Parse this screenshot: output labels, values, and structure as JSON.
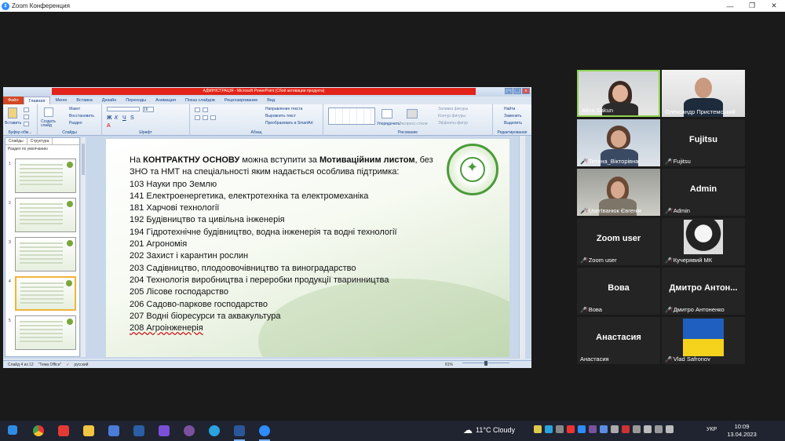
{
  "window": {
    "title": "Zoom Конференция",
    "controls": [
      "—",
      "❐",
      "✕"
    ]
  },
  "ppt": {
    "title": "АДМІНІСТРАЦІЯ - Microsoft PowerPoint (Сбой активации продукта)",
    "tabs": [
      "Файл",
      "Главная",
      "Меню",
      "Вставка",
      "Дизайн",
      "Переходы",
      "Анимация",
      "Показ слайдов",
      "Рецензирование",
      "Вид"
    ],
    "ribbon": {
      "paste": "Вставить",
      "new_slide": "Создать слайд",
      "layout": "Макет",
      "reset": "Восстановить",
      "section": "Раздел",
      "groups": [
        "Буфер обм...",
        "Слайды",
        "Шрифт",
        "Абзац",
        "Рисование",
        "Редактирование"
      ],
      "font_size": "16",
      "text_direction": "Направление текста",
      "align_text": "Выровнять текст",
      "smartart": "Преобразовать в SmartArt",
      "arrange": "Упорядочить",
      "quick_styles": "Экспресс-стили",
      "shape_fill": "Заливка фигуры",
      "shape_outline": "Контур фигуры",
      "shape_effects": "Эффекты фигур",
      "find": "Найти",
      "replace": "Заменить",
      "select": "Выделить"
    },
    "pane_tabs": [
      "Слайды",
      "Структура"
    ],
    "section_label": "Раздел по умолчанию",
    "thumbnails": [
      "1",
      "2",
      "3",
      "4",
      "5"
    ],
    "slide": {
      "intro_parts": [
        "На ",
        "КОНТРАКТНУ ОСНОВУ",
        " можна вступити за ",
        "Мотиваційним листом",
        ", без"
      ],
      "intro_line2": "ЗНО та НМТ на спеціальності яким надається особлива підтримка:",
      "items": [
        "103 Науки про Землю",
        "141 Електроенергетика, електротехніка та електромеханіка",
        "181 Харчові технології",
        "192 Будівництво та цивільна інженерія",
        "194 Гідротехнічне будівництво, водна інженерія та водні технології",
        "201 Агрономія",
        "202 Захист і карантин рослин",
        "203 Садівництво, плодоовочівництво та виноградарство",
        "204 Технологія виробництва і  переробки продукції тваринництва",
        "205 Лісове господарство",
        "206 Садово-паркове господарство",
        "207 Водні біоресурси та аквакультура",
        "208 Агроінженерія"
      ]
    },
    "status": {
      "slide": "Слайд 4 из 12",
      "theme": "\"Тема Office\"",
      "lang": "русский",
      "zoom": "81%"
    }
  },
  "participants": [
    {
      "name": "Alina Sakun",
      "video": true,
      "muted": false
    },
    {
      "name": "Олександр Пристемський",
      "video": true,
      "muted": false
    },
    {
      "name": "Тетяна_Вікторівна",
      "video": true,
      "muted": true
    },
    {
      "name": "Fujitsu",
      "big": "Fujitsu",
      "video": false,
      "muted": true
    },
    {
      "name": "UserIванюк Євгенія",
      "video": true,
      "muted": true
    },
    {
      "name": "Admin",
      "big": "Admin",
      "video": false,
      "muted": true
    },
    {
      "name": "Zoom user",
      "big": "Zoom user",
      "video": false,
      "muted": true
    },
    {
      "name": "Кучерявий МК",
      "video": true,
      "muted": true
    },
    {
      "name": "Вова",
      "big": "Вова",
      "video": false,
      "muted": true
    },
    {
      "name": "Дмитро Антоненко",
      "big": "Дмитро Антон...",
      "video": false,
      "muted": true
    },
    {
      "name": "Анастасия",
      "big": "Анастасия",
      "video": false,
      "muted": false
    },
    {
      "name": "Vlad Safronov",
      "video": true,
      "muted": true
    }
  ],
  "taskbar": {
    "weather": "11°C  Cloudy",
    "lang": "УКР",
    "time": "10:09",
    "date": "13.04.2023"
  },
  "colors": {
    "mic_muted": "#e03b3b",
    "active_speaker": "#8fd14f",
    "zoom_blue": "#2d8cff"
  }
}
